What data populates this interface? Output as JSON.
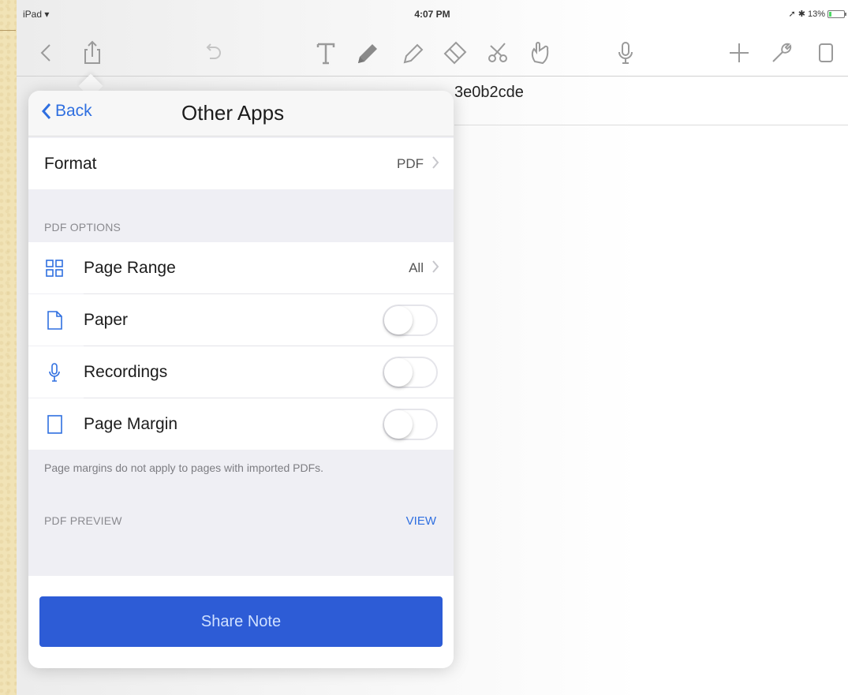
{
  "status_bar": {
    "device": "iPad",
    "time": "4:07 PM",
    "battery": "13%"
  },
  "toolbar": {
    "icons": [
      "back-icon",
      "share-icon",
      "undo-icon",
      "text-icon",
      "pen-icon",
      "highlighter-icon",
      "eraser-icon",
      "lasso-icon",
      "hand-icon",
      "microphone-icon",
      "add-icon",
      "wrench-icon",
      "page-icon"
    ]
  },
  "document": {
    "title_visible": "3e0b2cde"
  },
  "popover": {
    "back_label": "Back",
    "title": "Other Apps",
    "format": {
      "label": "Format",
      "value": "PDF"
    },
    "pdf_options_header": "PDF OPTIONS",
    "options": [
      {
        "label": "Page Range",
        "value": "All",
        "control": "disclosure",
        "icon": "grid-icon"
      },
      {
        "label": "Paper",
        "control": "toggle",
        "on": false,
        "icon": "paper-icon"
      },
      {
        "label": "Recordings",
        "control": "toggle",
        "on": false,
        "icon": "microphone-icon"
      },
      {
        "label": "Page Margin",
        "control": "toggle",
        "on": false,
        "icon": "page-margin-icon"
      }
    ],
    "footnote": "Page margins do not apply to pages with imported PDFs.",
    "pdf_preview_header": "PDF PREVIEW",
    "view_label": "VIEW",
    "share_button": "Share Note"
  },
  "colors": {
    "accent": "#2f6fe0",
    "share_button": "#2d5cd6",
    "icon_gray": "#9a9a9a"
  }
}
